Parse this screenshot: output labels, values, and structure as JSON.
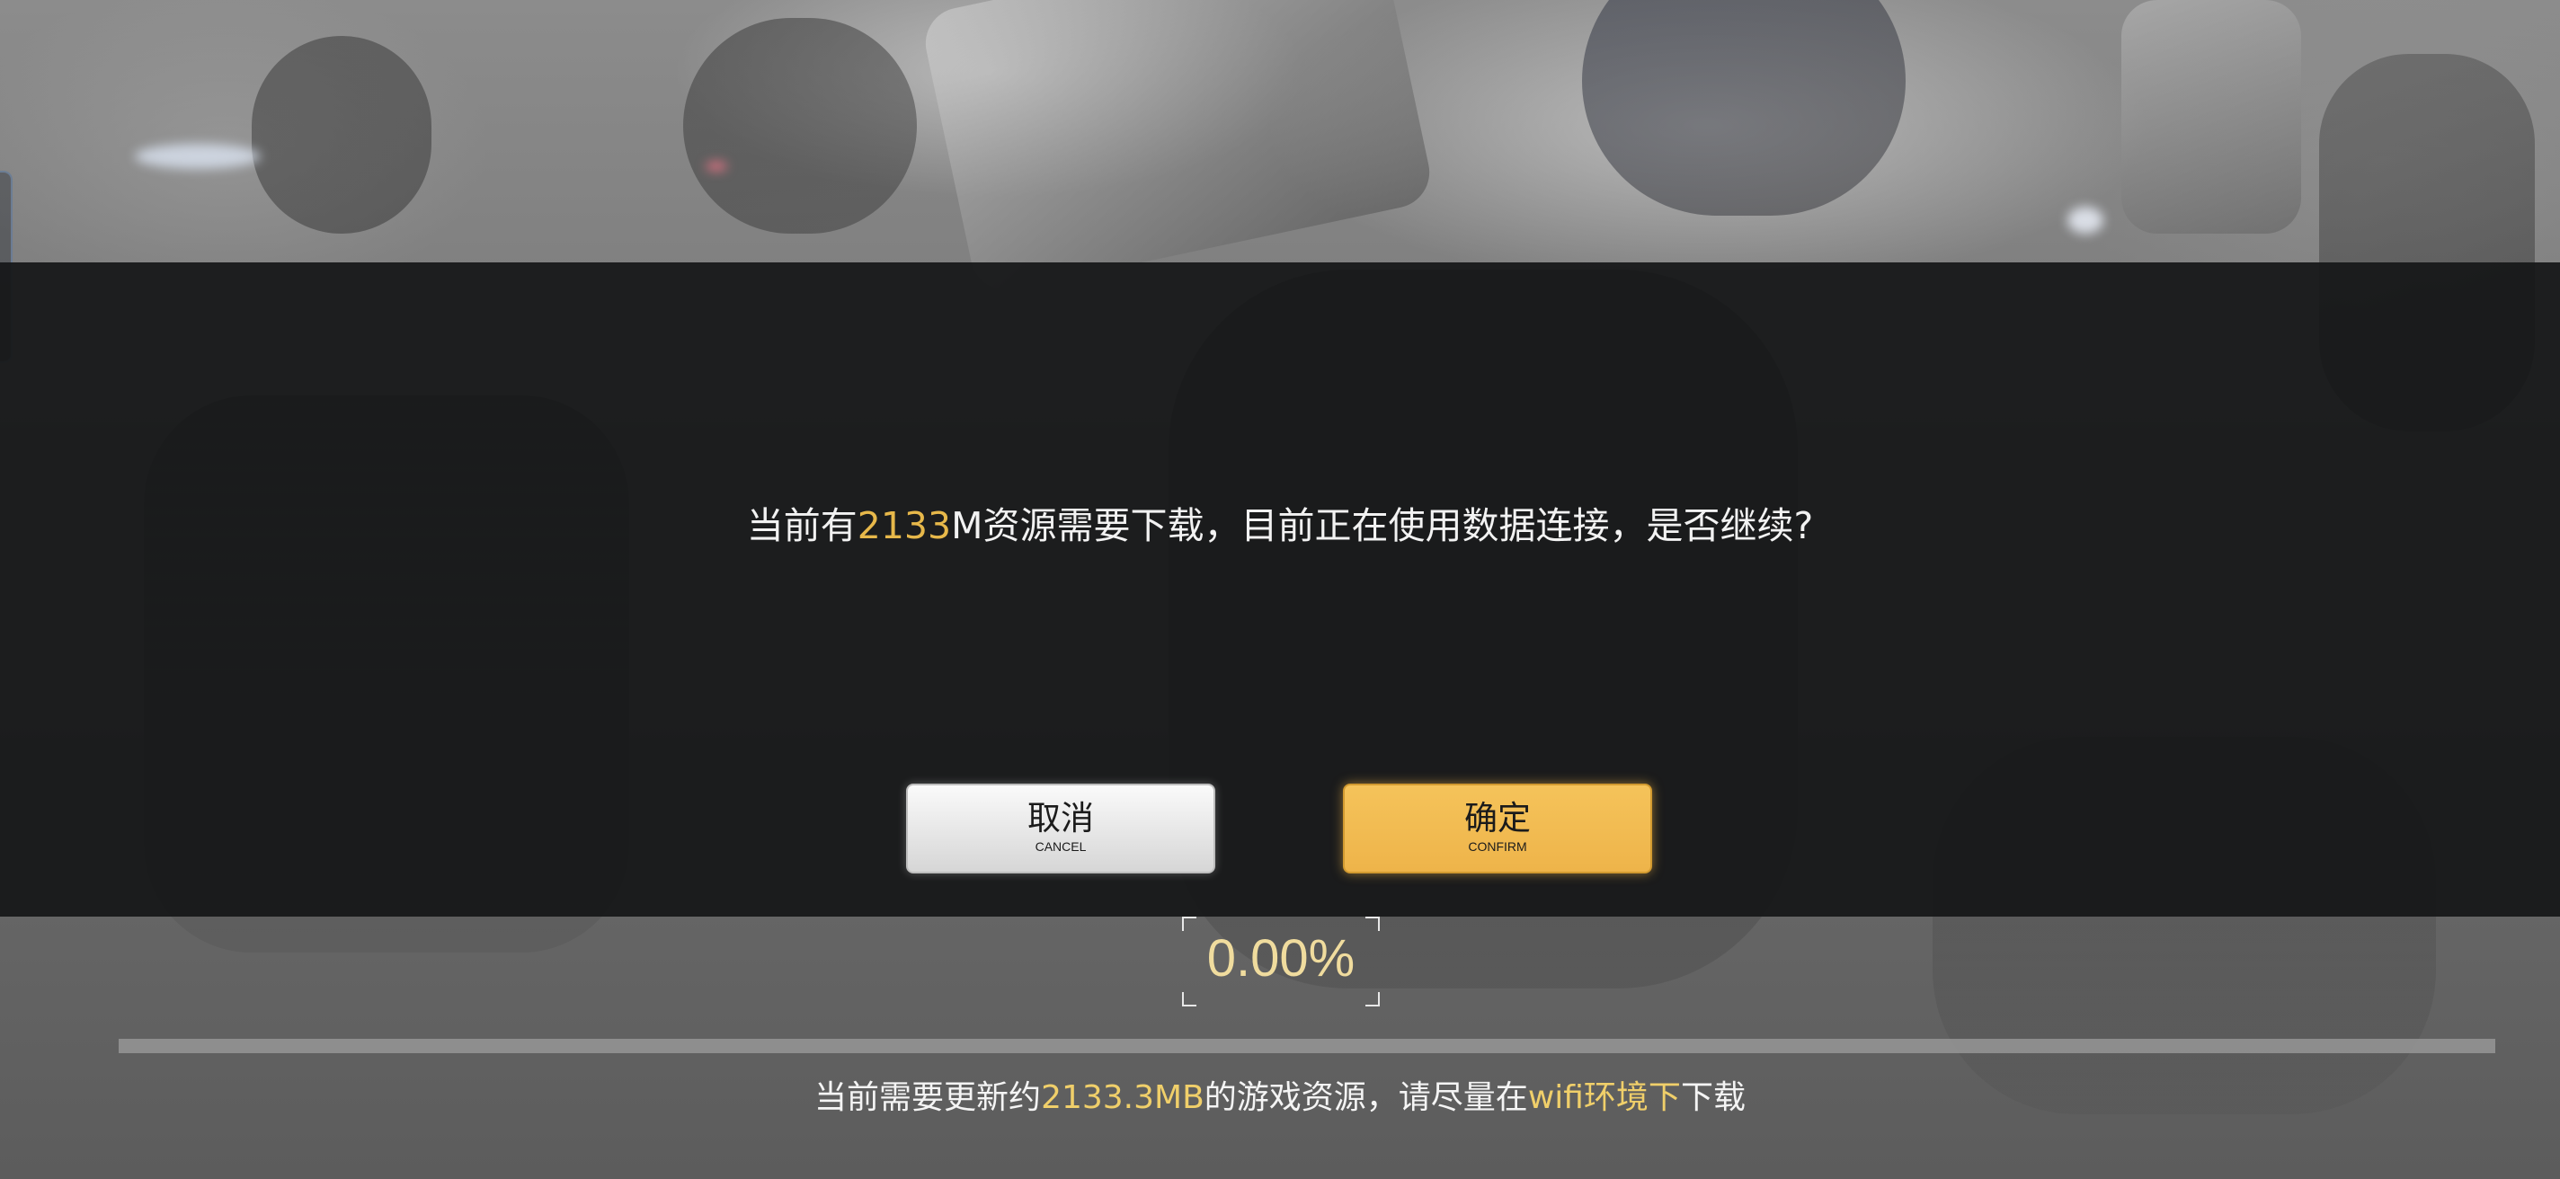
{
  "dialog": {
    "message_prefix": "当前有",
    "message_size": "2133",
    "message_suffix": "M资源需要下载，目前正在使用数据连接，是否继续?",
    "cancel_label": "取消",
    "cancel_sublabel": "CANCEL",
    "confirm_label": "确定",
    "confirm_sublabel": "CONFIRM"
  },
  "progress": {
    "percent_text": "0.00%",
    "fraction": 0.0
  },
  "footer": {
    "text_prefix": "当前需要更新约",
    "size": "2133.3MB",
    "text_middle": "的游戏资源，请尽量在",
    "network": "wifi环境下",
    "text_suffix": "下载"
  },
  "colors": {
    "accent": "#e7b84a",
    "dialog_bg": "#161718",
    "confirm_button": "#f5c35a",
    "cancel_button": "#e6e6e6"
  }
}
